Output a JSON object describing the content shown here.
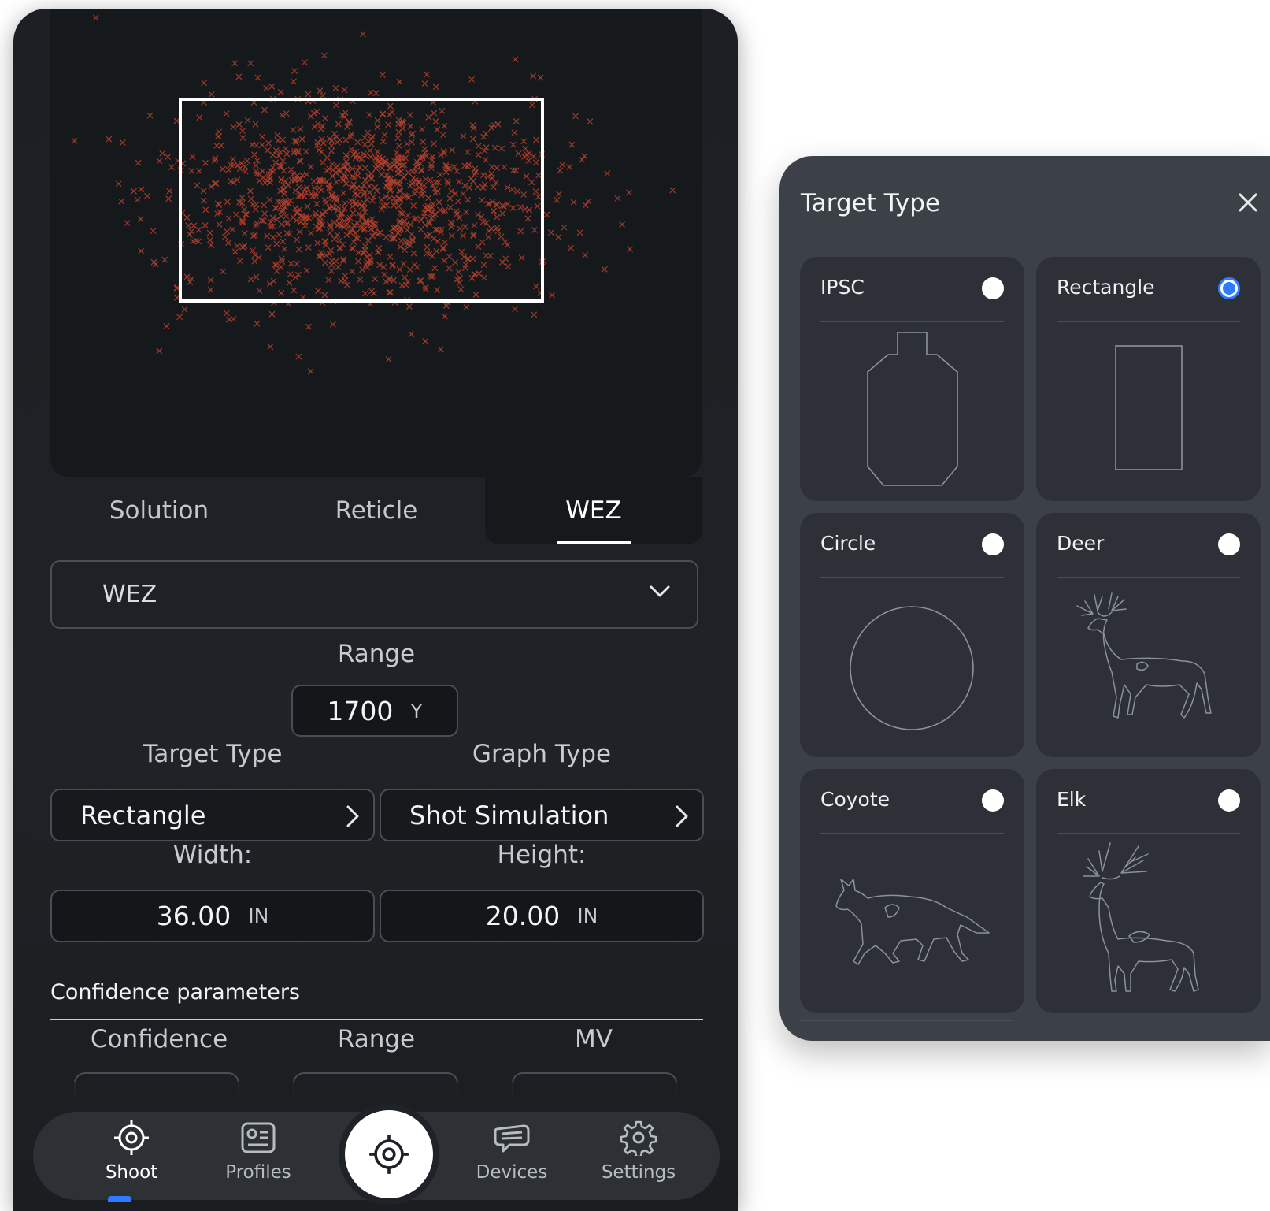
{
  "tabs": [
    {
      "label": "Solution",
      "active": false
    },
    {
      "label": "Reticle",
      "active": false
    },
    {
      "label": "WEZ",
      "active": true
    }
  ],
  "mode_select": {
    "value": "WEZ"
  },
  "range": {
    "label": "Range",
    "value": "1700",
    "unit": "Y"
  },
  "target_type": {
    "label": "Target Type",
    "value": "Rectangle"
  },
  "graph_type": {
    "label": "Graph Type",
    "value": "Shot Simulation"
  },
  "width": {
    "label": "Width:",
    "value": "36.00",
    "unit": "IN"
  },
  "height": {
    "label": "Height:",
    "value": "20.00",
    "unit": "IN"
  },
  "confidence": {
    "title": "Confidence parameters",
    "columns": [
      "Confidence",
      "Range",
      "MV"
    ]
  },
  "nav": {
    "items": [
      {
        "label": "Shoot",
        "icon": "crosshair-icon",
        "active": true
      },
      {
        "label": "Profiles",
        "icon": "profile-card-icon",
        "active": false
      },
      {
        "label": "Devices",
        "icon": "device-icon",
        "active": false
      },
      {
        "label": "Settings",
        "icon": "gear-icon",
        "active": false
      }
    ],
    "center_icon": "crosshair-icon"
  },
  "panel": {
    "title": "Target Type",
    "options": [
      {
        "name": "IPSC",
        "selected": false,
        "icon": "ipsc-target-icon"
      },
      {
        "name": "Rectangle",
        "selected": true,
        "icon": "rectangle-target-icon"
      },
      {
        "name": "Circle",
        "selected": false,
        "icon": "circle-target-icon"
      },
      {
        "name": "Deer",
        "selected": false,
        "icon": "deer-target-icon"
      },
      {
        "name": "Coyote",
        "selected": false,
        "icon": "coyote-target-icon"
      },
      {
        "name": "Elk",
        "selected": false,
        "icon": "elk-target-icon"
      }
    ]
  },
  "colors": {
    "accent": "#2f7bff",
    "shot": "#b8402c",
    "target_outline": "#ffffff"
  }
}
